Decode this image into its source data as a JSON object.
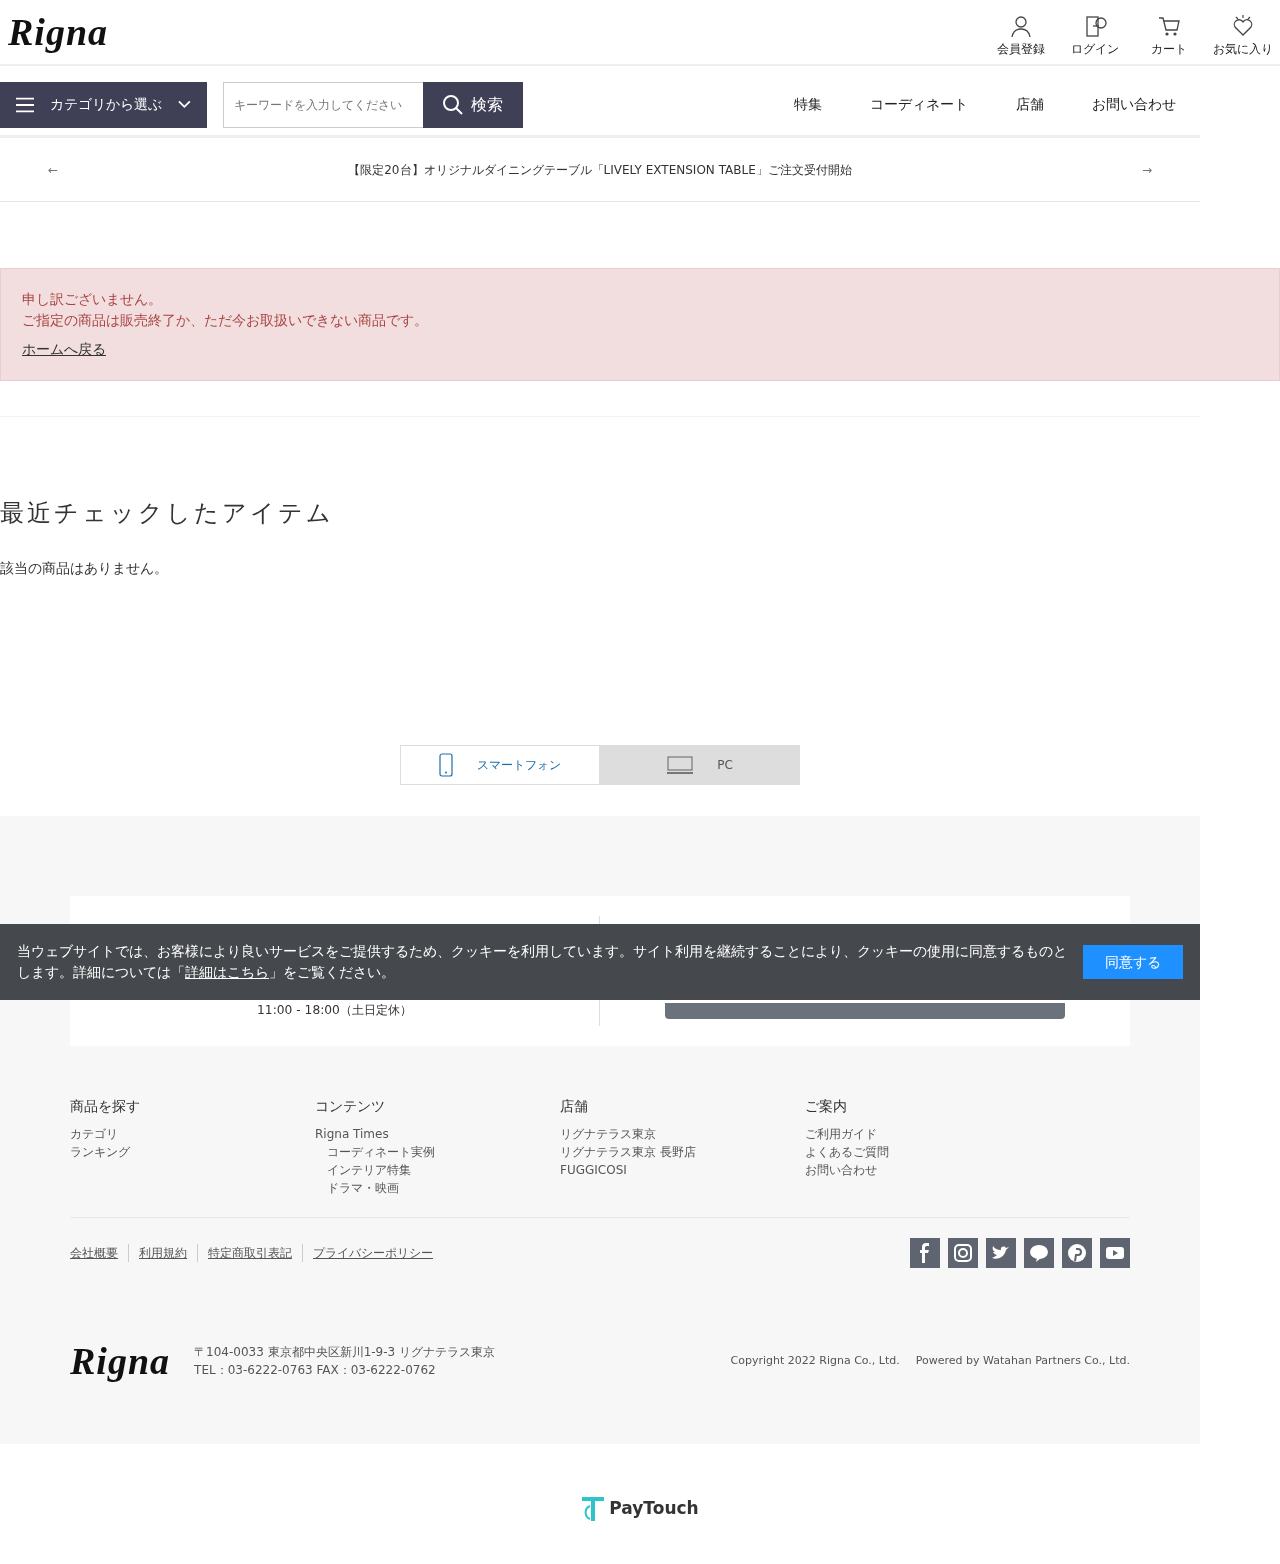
{
  "header": {
    "logo": "Rigna",
    "user_links": [
      {
        "kind": "member",
        "label": "会員登録"
      },
      {
        "kind": "login",
        "label": "ログイン"
      },
      {
        "kind": "cart",
        "label": "カート"
      },
      {
        "kind": "favorite",
        "label": "お気に入り"
      }
    ]
  },
  "navbar": {
    "category_button": "カテゴリから選ぶ",
    "search": {
      "placeholder": "キーワードを入力してください",
      "button": "検索"
    },
    "links": [
      "特集",
      "コーディネート",
      "店舗",
      "お問い合わせ"
    ]
  },
  "notice_bar": {
    "prev": "←",
    "text": "【限定20台】オリジナルダイニングテーブル「LIVELY EXTENSION TABLE」ご注文受付開始",
    "next": "→"
  },
  "alert": {
    "lines": [
      "申し訳ございません。",
      "ご指定の商品は販売終了か、ただ今お取扱いできない商品です。"
    ],
    "link": "ホームへ戻る"
  },
  "recent": {
    "title": "最近チェックしたアイテム",
    "empty": "該当の商品はありません。"
  },
  "device_switch": [
    {
      "kind": "phone",
      "label": "スマートフォン",
      "selected": true
    },
    {
      "kind": "pc",
      "label": "PC",
      "selected": false
    }
  ],
  "contact": {
    "phone": {
      "hours": "11:00 - 18:00（土日定休）"
    }
  },
  "footer_columns": [
    {
      "title": "商品を探す",
      "links": [
        {
          "label": "カテゴリ"
        },
        {
          "label": "ランキング"
        }
      ]
    },
    {
      "title": "コンテンツ",
      "links": [
        {
          "label": "Rigna Times",
          "children": [
            {
              "label": "コーディネート実例"
            },
            {
              "label": "インテリア特集"
            },
            {
              "label": "ドラマ・映画"
            }
          ]
        }
      ]
    },
    {
      "title": "店舗",
      "links": [
        {
          "label": "リグナテラス東京"
        },
        {
          "label": "リグナテラス東京 長野店"
        },
        {
          "label": "FUGGICOSI"
        }
      ]
    },
    {
      "title": "ご案内",
      "links": [
        {
          "label": "ご利用ガイド"
        },
        {
          "label": "よくあるご質問"
        },
        {
          "label": "お問い合わせ"
        }
      ]
    }
  ],
  "footer_links": [
    "会社概要",
    "利用規約",
    "特定商取引表記",
    "プライバシーポリシー"
  ],
  "footer_bottom": {
    "logo": "Rigna",
    "address": "〒104-0033 東京都中央区新川1-9-3 リグナテラス東京",
    "tel": "TEL：03-6222-0763 FAX：03-6222-0762",
    "copyright": "Copyright 2022 Rigna Co., Ltd.",
    "powered": "Powered by Watahan Partners Co., Ltd."
  },
  "cookie_banner": {
    "text": "当ウェブサイトでは、お客様により良いサービスをご提供するため、クッキーを利用しています。サイト利用を継続することにより、クッキーの使用に同意するものとします。詳細については「",
    "link": "詳細はこちら",
    "text_after": "」をご覧ください。",
    "button": "同意する"
  },
  "paytouch": {
    "label": "PayTouch"
  }
}
